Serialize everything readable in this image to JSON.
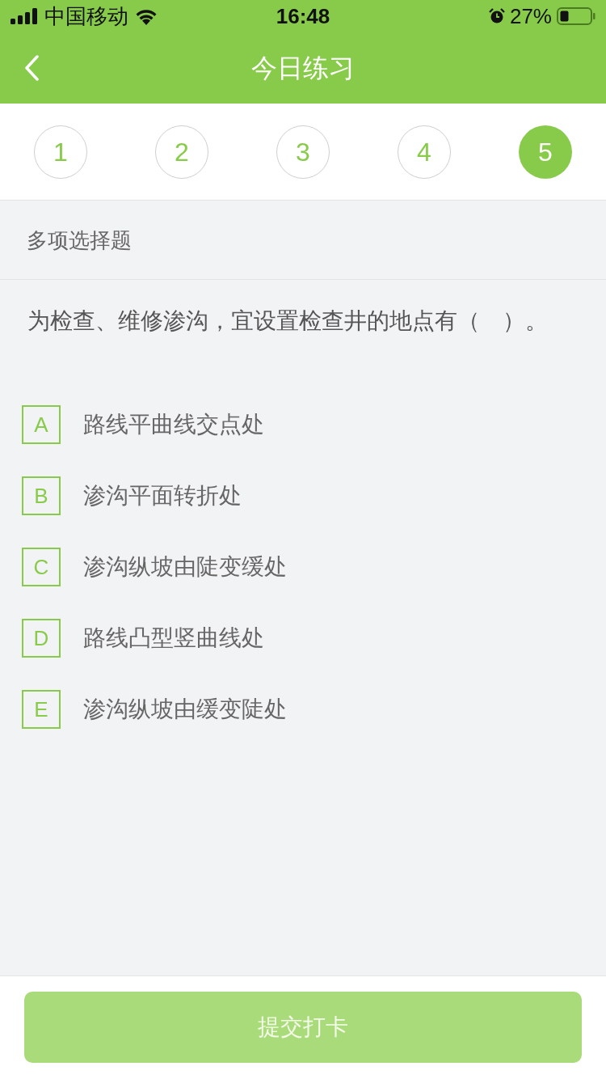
{
  "status_bar": {
    "carrier": "中国移动",
    "time": "16:48",
    "battery": "27%"
  },
  "nav": {
    "title": "今日练习"
  },
  "steps": [
    {
      "label": "1",
      "selected": false
    },
    {
      "label": "2",
      "selected": false
    },
    {
      "label": "3",
      "selected": false
    },
    {
      "label": "4",
      "selected": false
    },
    {
      "label": "5",
      "selected": true
    }
  ],
  "question": {
    "type_label": "多项选择题",
    "text": "为检查、维修渗沟，宜设置检查井的地点有（　）。",
    "options": [
      {
        "letter": "A",
        "text": "路线平曲线交点处",
        "selected": false
      },
      {
        "letter": "B",
        "text": "渗沟平面转折处",
        "selected": false
      },
      {
        "letter": "C",
        "text": "渗沟纵坡由陡变缓处",
        "selected": false
      },
      {
        "letter": "D",
        "text": "路线凸型竖曲线处",
        "selected": false
      },
      {
        "letter": "E",
        "text": "渗沟纵坡由缓变陡处",
        "selected": false
      }
    ]
  },
  "submit_button": {
    "label": "提交打卡",
    "disabled": true
  }
}
